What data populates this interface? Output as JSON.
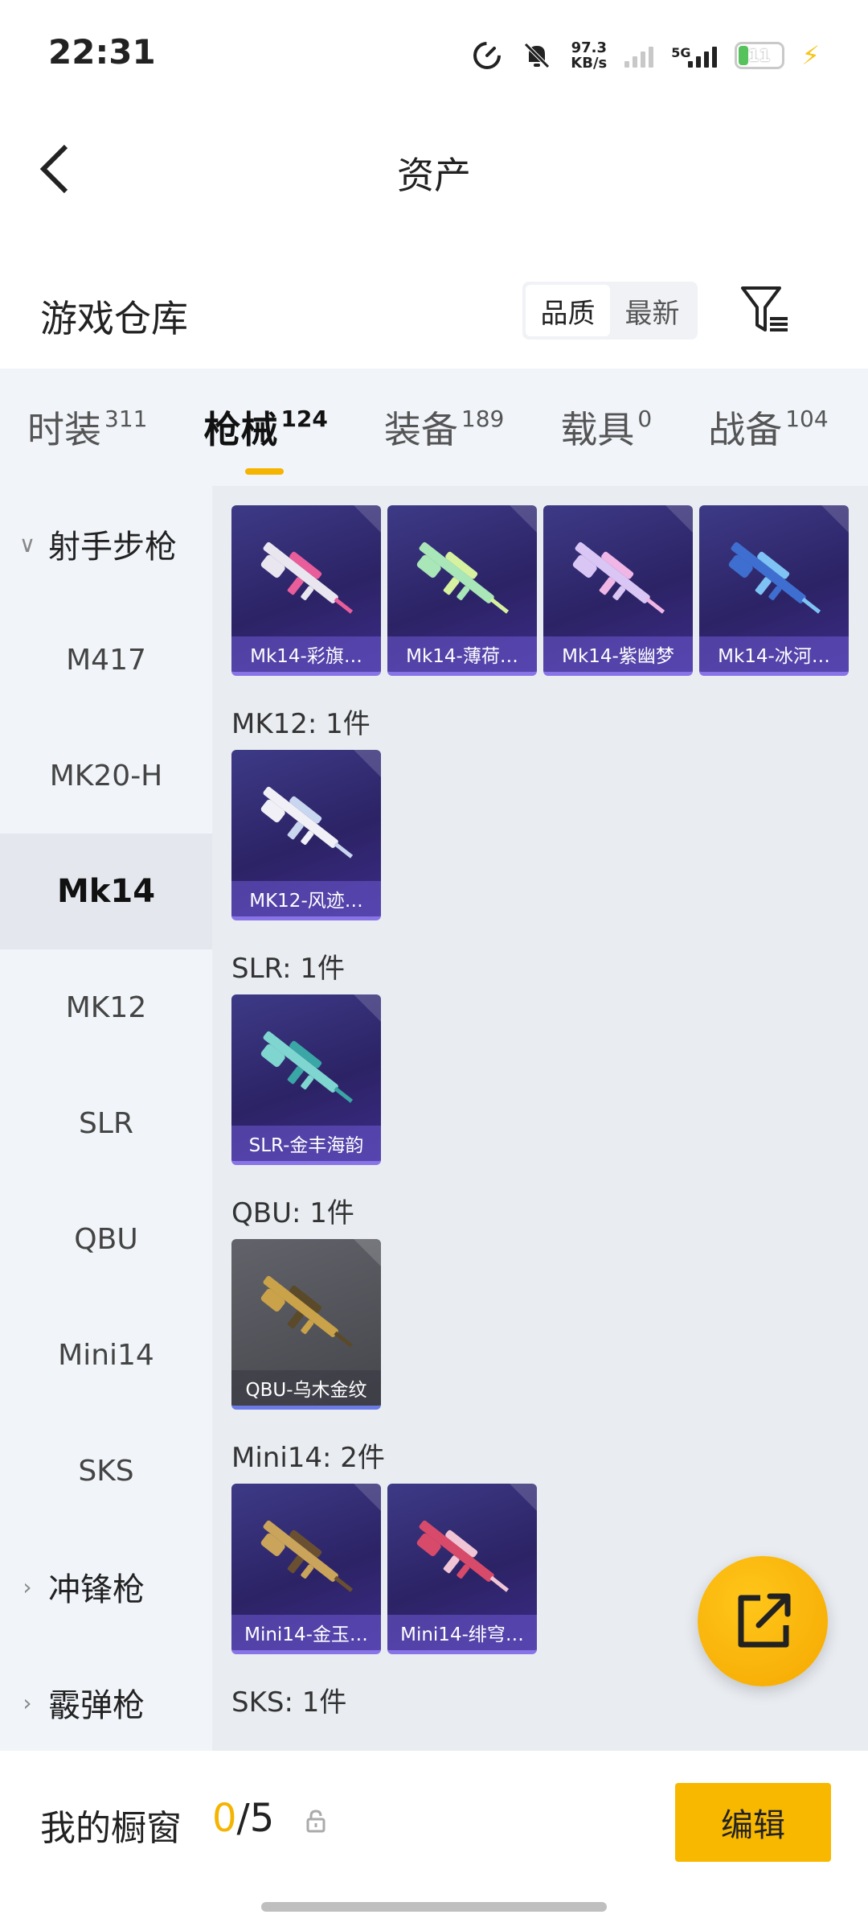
{
  "status_bar": {
    "time": "22:31",
    "speed_value": "97.3",
    "speed_unit": "KB/s",
    "network": "5G",
    "battery": "11",
    "icons": [
      "data-saver-icon",
      "mute-icon",
      "signal-icon",
      "5g-signal-icon",
      "battery-icon",
      "charging-bolt-icon"
    ]
  },
  "header": {
    "title": "资产",
    "back_icon": "back-arrow-icon"
  },
  "warehouse": {
    "title": "游戏仓库",
    "sort_options": [
      "品质",
      "最新"
    ],
    "selected_sort": "品质",
    "filter_icon": "filter-icon"
  },
  "tabs": [
    {
      "label": "时装",
      "count": "311",
      "active": false
    },
    {
      "label": "枪械",
      "count": "124",
      "active": true
    },
    {
      "label": "装备",
      "count": "189",
      "active": false
    },
    {
      "label": "载具",
      "count": "0",
      "active": false
    },
    {
      "label": "战备",
      "count": "104",
      "active": false
    }
  ],
  "sidebar": {
    "items": [
      {
        "label": "射手步枪",
        "type": "group-expanded"
      },
      {
        "label": "M417",
        "type": "item"
      },
      {
        "label": "MK20-H",
        "type": "item"
      },
      {
        "label": "Mk14",
        "type": "item",
        "active": true
      },
      {
        "label": "MK12",
        "type": "item"
      },
      {
        "label": "SLR",
        "type": "item"
      },
      {
        "label": "QBU",
        "type": "item"
      },
      {
        "label": "Mini14",
        "type": "item"
      },
      {
        "label": "SKS",
        "type": "item"
      },
      {
        "label": "冲锋枪",
        "type": "group-collapsed"
      },
      {
        "label": "霰弹枪",
        "type": "group-collapsed"
      }
    ]
  },
  "sections": [
    {
      "label": "",
      "items": [
        {
          "name": "Mk14-彩旗…",
          "color": "#e9e6f0",
          "accent": "#e85d9a"
        },
        {
          "name": "Mk14-薄荷…",
          "color": "#a9e6b8",
          "accent": "#d6f2a0"
        },
        {
          "name": "Mk14-紫幽梦",
          "color": "#d9c6f5",
          "accent": "#f0b6e6"
        },
        {
          "name": "Mk14-冰河…",
          "color": "#3e6fd0",
          "accent": "#7fc3f5"
        }
      ]
    },
    {
      "label": "MK12: 1件",
      "items": [
        {
          "name": "MK12-风迹…",
          "color": "#f0f0f6",
          "accent": "#c9d6f0"
        }
      ]
    },
    {
      "label": "SLR: 1件",
      "items": [
        {
          "name": "SLR-金丰海韵",
          "color": "#7fd6d0",
          "accent": "#3aa6a6"
        }
      ]
    },
    {
      "label": "QBU: 1件",
      "items": [
        {
          "name": "QBU-乌木金纹",
          "color": "#c9a24a",
          "accent": "#5a4a2a",
          "gray": true
        }
      ]
    },
    {
      "label": "Mini14: 2件",
      "items": [
        {
          "name": "Mini14-金玉…",
          "color": "#c9a45a",
          "accent": "#6a5030"
        },
        {
          "name": "Mini14-绯穹…",
          "color": "#d84a6a",
          "accent": "#f0c6d6"
        }
      ]
    },
    {
      "label": "SKS: 1件",
      "items": []
    }
  ],
  "bottom_bar": {
    "label": "我的橱窗",
    "current": "0",
    "separator": "/",
    "total": "5",
    "lock_icon": "lock-icon",
    "edit_button": "编辑"
  },
  "fab": {
    "icon": "share-external-icon"
  }
}
